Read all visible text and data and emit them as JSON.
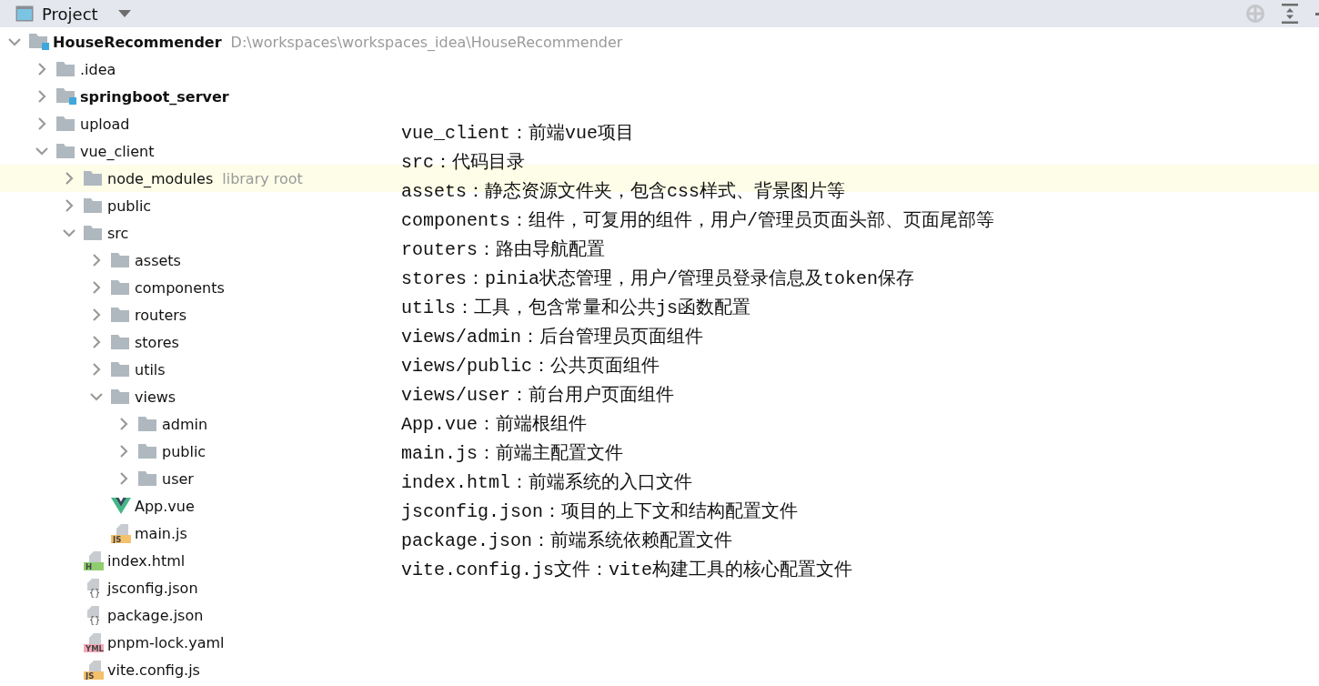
{
  "header": {
    "title": "Project"
  },
  "tree": [
    {
      "label": "HouseRecommender",
      "hint": "D:\\workspaces\\workspaces_idea\\HouseRecommender",
      "kind": "module",
      "expanded": true,
      "selected": false,
      "children": [
        {
          "label": ".idea",
          "kind": "folder",
          "expanded": false,
          "selected": false
        },
        {
          "label": "springboot_server",
          "kind": "module",
          "expanded": false,
          "selected": false
        },
        {
          "label": "upload",
          "kind": "folder",
          "expanded": false,
          "selected": false
        },
        {
          "label": "vue_client",
          "kind": "folder",
          "expanded": true,
          "selected": false,
          "children": [
            {
              "label": "node_modules",
              "hint": "library root",
              "kind": "folder",
              "expanded": false,
              "selected": true
            },
            {
              "label": "public",
              "kind": "folder",
              "expanded": false,
              "selected": false
            },
            {
              "label": "src",
              "kind": "folder",
              "expanded": true,
              "selected": false,
              "children": [
                {
                  "label": "assets",
                  "kind": "folder",
                  "expanded": false,
                  "selected": false
                },
                {
                  "label": "components",
                  "kind": "folder",
                  "expanded": false,
                  "selected": false
                },
                {
                  "label": "routers",
                  "kind": "folder",
                  "expanded": false,
                  "selected": false
                },
                {
                  "label": "stores",
                  "kind": "folder",
                  "expanded": false,
                  "selected": false
                },
                {
                  "label": "utils",
                  "kind": "folder",
                  "expanded": false,
                  "selected": false
                },
                {
                  "label": "views",
                  "kind": "folder",
                  "expanded": true,
                  "selected": false,
                  "children": [
                    {
                      "label": "admin",
                      "kind": "folder",
                      "expanded": false,
                      "selected": false
                    },
                    {
                      "label": "public",
                      "kind": "folder",
                      "expanded": false,
                      "selected": false
                    },
                    {
                      "label": "user",
                      "kind": "folder",
                      "expanded": false,
                      "selected": false
                    }
                  ]
                },
                {
                  "label": "App.vue",
                  "kind": "vue",
                  "selected": false
                },
                {
                  "label": "main.js",
                  "kind": "file",
                  "badge": "JS",
                  "color": "#f4c06b",
                  "selected": false
                }
              ]
            },
            {
              "label": "index.html",
              "kind": "file",
              "badge": "H",
              "color": "#8fcd6f",
              "selected": false
            },
            {
              "label": "jsconfig.json",
              "kind": "json",
              "badge": "{}",
              "selected": false
            },
            {
              "label": "package.json",
              "kind": "json",
              "badge": "{}",
              "selected": false
            },
            {
              "label": "pnpm-lock.yaml",
              "kind": "file",
              "badge": "YML",
              "color": "#f5a9b8",
              "selected": false
            },
            {
              "label": "vite.config.js",
              "kind": "file",
              "badge": "JS",
              "color": "#f4c06b",
              "selected": false
            }
          ]
        }
      ]
    }
  ],
  "annotations": [
    "vue_client：前端vue项目",
    "src：代码目录",
    "assets：静态资源文件夹，包含css样式、背景图片等",
    "components：组件，可复用的组件，用户/管理员页面头部、页面尾部等",
    "routers：路由导航配置",
    "stores：pinia状态管理，用户/管理员登录信息及token保存",
    "utils：工具，包含常量和公共js函数配置",
    "views/admin：后台管理员页面组件",
    "views/public：公共页面组件",
    "views/user：前台用户页面组件",
    "App.vue：前端根组件",
    "main.js：前端主配置文件",
    "index.html：前端系统的入口文件",
    "jsconfig.json：项目的上下文和结构配置文件",
    "package.json：前端系统依赖配置文件",
    "vite.config.js文件：vite构建工具的核心配置文件"
  ]
}
